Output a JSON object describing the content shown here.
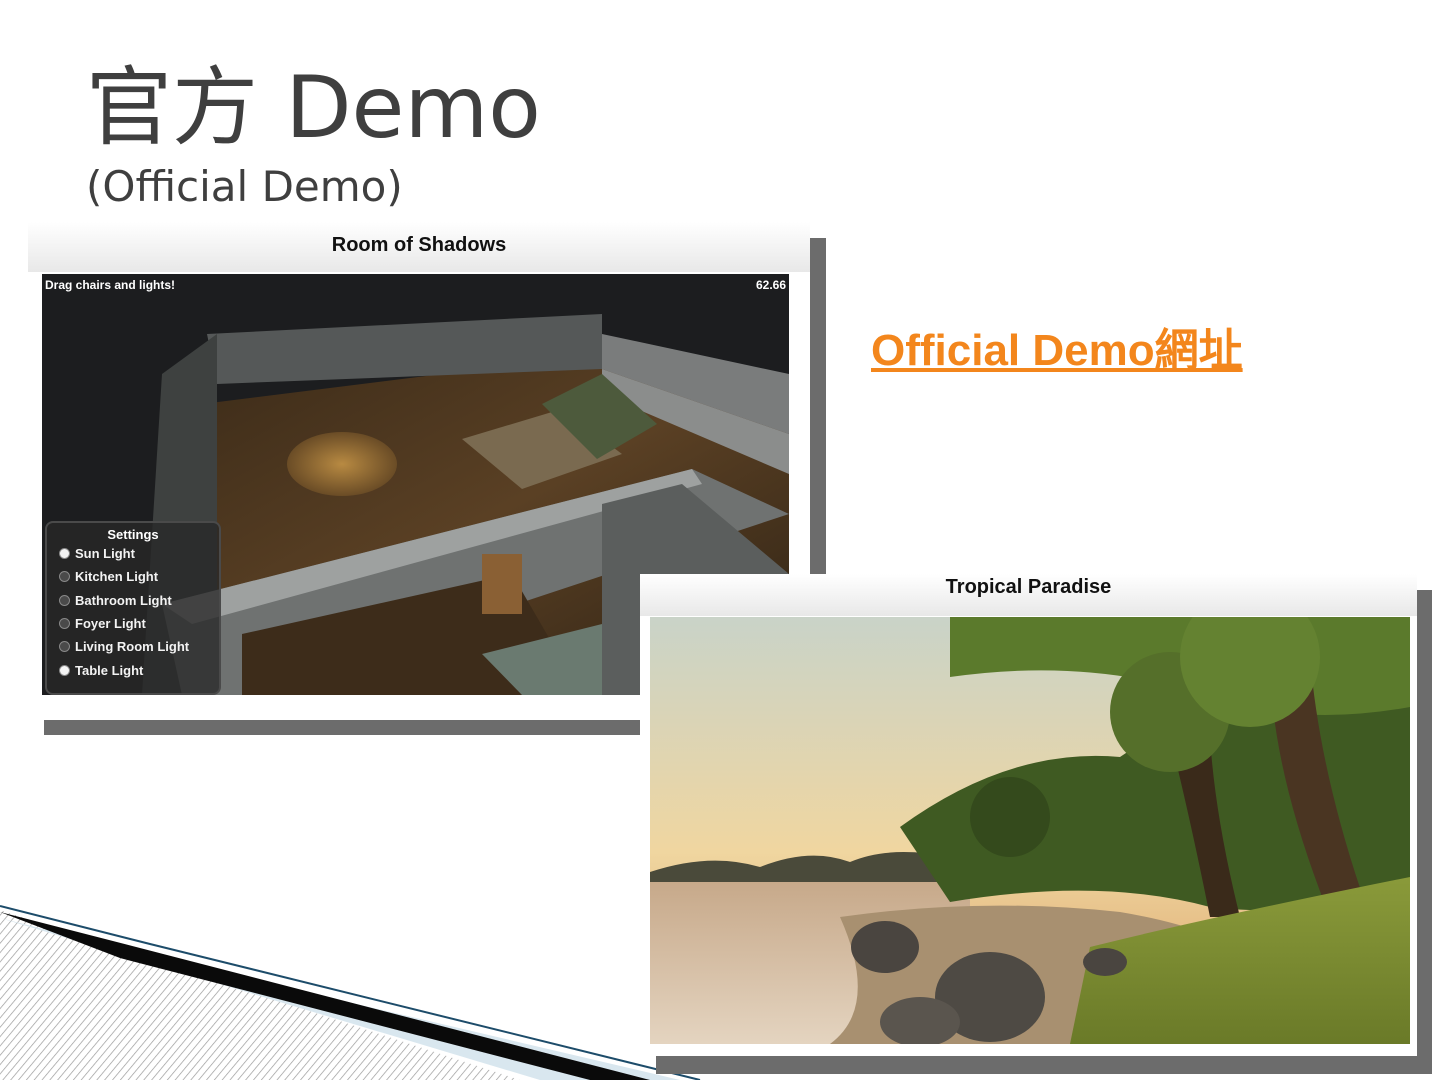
{
  "slide": {
    "title": "官方 Demo",
    "subtitle": "(Official Demo)",
    "link_text": "Official Demo網址",
    "link_color": "#f3861c"
  },
  "room_demo": {
    "window_title": "Room of Shadows",
    "hint_text": "Drag chairs and lights!",
    "fps_readout": "62.66",
    "settings": {
      "title": "Settings",
      "options": [
        {
          "label": "Sun Light",
          "checked": true
        },
        {
          "label": "Kitchen Light",
          "checked": false
        },
        {
          "label": "Bathroom Light",
          "checked": false
        },
        {
          "label": "Foyer Light",
          "checked": false
        },
        {
          "label": "Living Room Light",
          "checked": false
        },
        {
          "label": "Table Light",
          "checked": true
        }
      ]
    }
  },
  "tropical_demo": {
    "window_title": "Tropical Paradise"
  }
}
